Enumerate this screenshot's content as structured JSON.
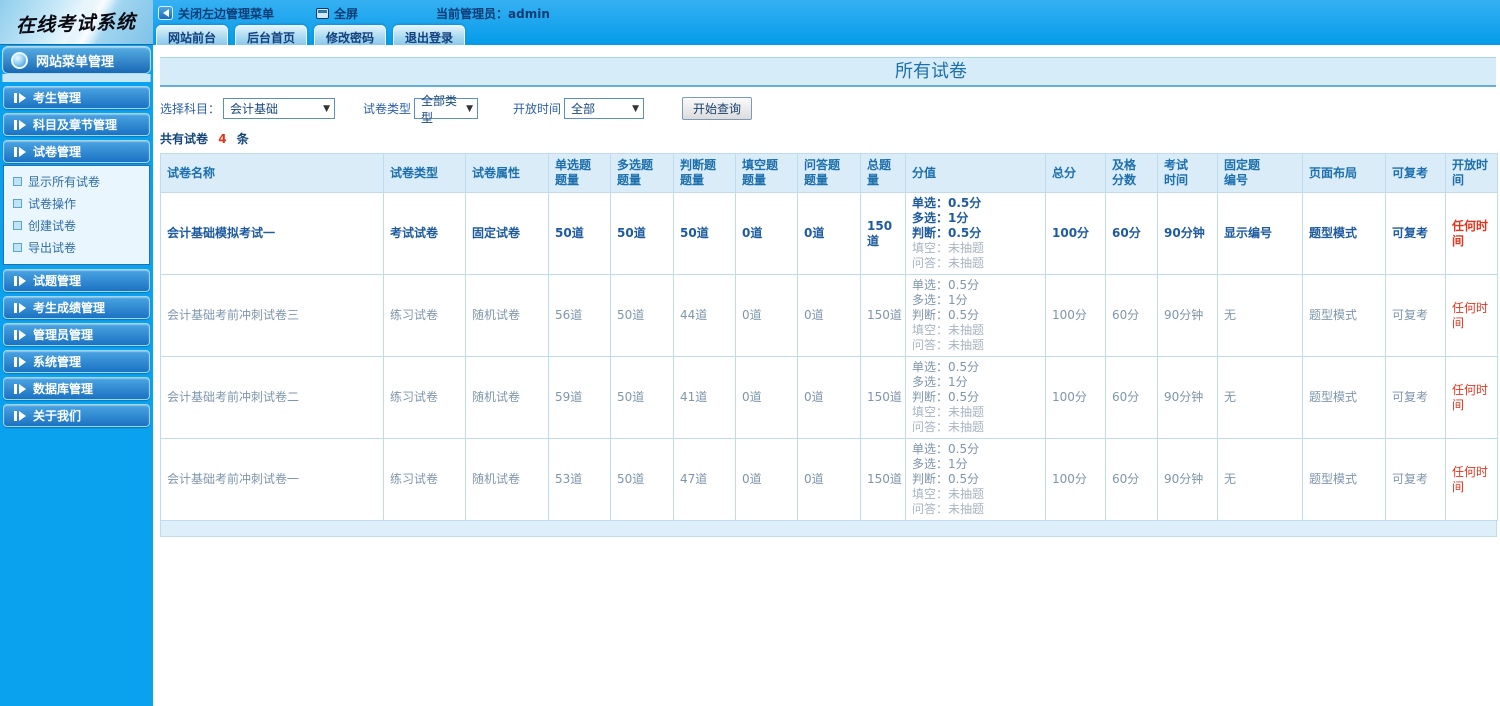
{
  "logo": {
    "title": "在线考试系统"
  },
  "topbar": {
    "close_menu_label": "关闭左边管理菜单",
    "fullscreen_label": "全屏",
    "admin_label": "当前管理员：admin"
  },
  "tabs": [
    {
      "label": "网站前台"
    },
    {
      "label": "后台首页"
    },
    {
      "label": "修改密码"
    },
    {
      "label": "退出登录"
    }
  ],
  "sidebar": {
    "header": "网站菜单管理",
    "groups": [
      {
        "label": "考生管理"
      },
      {
        "label": "科目及章节管理"
      },
      {
        "label": "试卷管理",
        "expanded": true,
        "items": [
          "显示所有试卷",
          "试卷操作",
          "创建试卷",
          "导出试卷"
        ]
      },
      {
        "label": "试题管理"
      },
      {
        "label": "考生成绩管理"
      },
      {
        "label": "管理员管理"
      },
      {
        "label": "系统管理"
      },
      {
        "label": "数据库管理"
      },
      {
        "label": "关于我们"
      }
    ]
  },
  "main": {
    "title": "所有试卷",
    "filters": {
      "subject_label": "选择科目：",
      "subject_value": "会计基础",
      "type_label": "试卷类型",
      "type_value": "全部类型",
      "time_label": "开放时间",
      "time_value": "全部",
      "query_button": "开始查询"
    },
    "count": {
      "prefix": "共有试卷",
      "value": "4",
      "suffix": "条"
    }
  },
  "table": {
    "headers": [
      "试卷名称",
      "试卷类型",
      "试卷属性",
      "单选题\n题量",
      "多选题\n题量",
      "判断题\n题量",
      "填空题\n题量",
      "问答题\n题量",
      "总题量",
      "分值",
      "总分",
      "及格\n分数",
      "考试\n时间",
      "固定题\n编号",
      "页面布局",
      "可复考",
      "开放时间"
    ],
    "rows": [
      {
        "bold": true,
        "name": "会计基础模拟考试一",
        "type": "考试试卷",
        "attr": "固定试卷",
        "single": "50道",
        "multi": "50道",
        "judge": "50道",
        "blank": "0道",
        "qa": "0道",
        "total_q": "150道",
        "score_lines": [
          "单选：0.5分",
          "多选：1分",
          "判断：0.5分"
        ],
        "score_muted": [
          "填空：未抽题",
          "问答：未抽题"
        ],
        "total_score": "100分",
        "pass": "60分",
        "time": "90分钟",
        "fixed_no": "显示编号",
        "layout": "题型模式",
        "retake": "可复考",
        "open": "任何时间"
      },
      {
        "bold": false,
        "name": "会计基础考前冲刺试卷三",
        "type": "练习试卷",
        "attr": "随机试卷",
        "single": "56道",
        "multi": "50道",
        "judge": "44道",
        "blank": "0道",
        "qa": "0道",
        "total_q": "150道",
        "score_lines": [
          "单选：0.5分",
          "多选：1分",
          "判断：0.5分"
        ],
        "score_muted": [
          "填空：未抽题",
          "问答：未抽题"
        ],
        "total_score": "100分",
        "pass": "60分",
        "time": "90分钟",
        "fixed_no": "无",
        "layout": "题型模式",
        "retake": "可复考",
        "open": "任何时间"
      },
      {
        "bold": false,
        "name": "会计基础考前冲刺试卷二",
        "type": "练习试卷",
        "attr": "随机试卷",
        "single": "59道",
        "multi": "50道",
        "judge": "41道",
        "blank": "0道",
        "qa": "0道",
        "total_q": "150道",
        "score_lines": [
          "单选：0.5分",
          "多选：1分",
          "判断：0.5分"
        ],
        "score_muted": [
          "填空：未抽题",
          "问答：未抽题"
        ],
        "total_score": "100分",
        "pass": "60分",
        "time": "90分钟",
        "fixed_no": "无",
        "layout": "题型模式",
        "retake": "可复考",
        "open": "任何时间"
      },
      {
        "bold": false,
        "name": "会计基础考前冲刺试卷一",
        "type": "练习试卷",
        "attr": "随机试卷",
        "single": "53道",
        "multi": "50道",
        "judge": "47道",
        "blank": "0道",
        "qa": "0道",
        "total_q": "150道",
        "score_lines": [
          "单选：0.5分",
          "多选：1分",
          "判断：0.5分"
        ],
        "score_muted": [
          "填空：未抽题",
          "问答：未抽题"
        ],
        "total_score": "100分",
        "pass": "60分",
        "time": "90分钟",
        "fixed_no": "无",
        "layout": "题型模式",
        "retake": "可复考",
        "open": "任何时间"
      }
    ]
  },
  "colors": {
    "header_blue": "#0aa1ef",
    "navy_text": "#16477c",
    "table_header_text": "#1d6fad",
    "row_bold_text": "#1d5a9e",
    "row_normal_text": "#7e96ac",
    "muted_text": "#a7b4c1",
    "alert_red": "#e2341d",
    "table_border": "#bfdcef"
  }
}
